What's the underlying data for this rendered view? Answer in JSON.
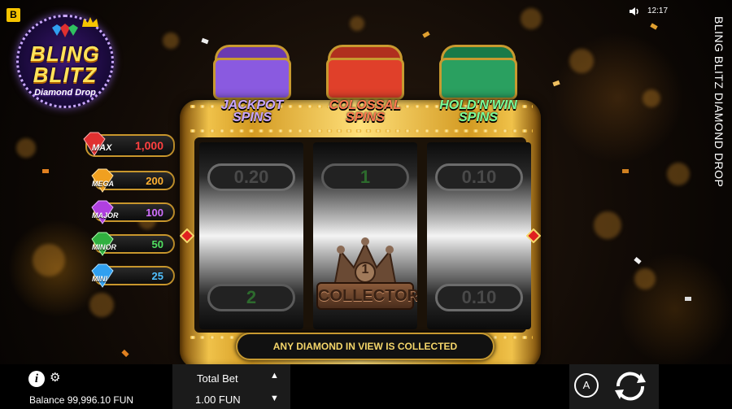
{
  "brand_badge": "B",
  "logo": {
    "line1": "BLING",
    "line2": "BLITZ",
    "subtitle": "Diamond Drop"
  },
  "status": {
    "time": "12:17",
    "sound_icon": "speaker-icon"
  },
  "side_title": "BLING BLITZ DIAMOND DROP",
  "jackpots": [
    {
      "name": "MAX",
      "value": "1,000",
      "color": "#e03030"
    },
    {
      "name": "MEGA",
      "value": "200",
      "color": "#f0a020"
    },
    {
      "name": "MAJOR",
      "value": "100",
      "color": "#b040e0"
    },
    {
      "name": "MINOR",
      "value": "50",
      "color": "#30b040"
    },
    {
      "name": "MINI",
      "value": "25",
      "color": "#30a0f0"
    }
  ],
  "chests": [
    {
      "label_line1": "JACKPOT",
      "label_line2": "SPINS",
      "color": "#8a5ae0",
      "text_color": "#c9a6ff"
    },
    {
      "label_line1": "COLOSSAL",
      "label_line2": "SPINS",
      "color": "#e0402a",
      "text_color": "#ff7a50"
    },
    {
      "label_line1": "HOLD'N'WIN",
      "label_line2": "SPINS",
      "color": "#2aa060",
      "text_color": "#7aff9a"
    }
  ],
  "reels": {
    "reel1": {
      "top": "0.20",
      "bottom": "2"
    },
    "reel2": {
      "top": "1",
      "collector_number": "1",
      "collector_label": "COLLECTOR"
    },
    "reel3": {
      "top": "0.10",
      "bottom": "0.10"
    }
  },
  "message": "ANY DIAMOND IN VIEW IS COLLECTED",
  "bottom_bar": {
    "info_label": "i",
    "balance": "Balance 99,996.10 FUN",
    "total_bet_label": "Total Bet",
    "total_bet_value": "1.00 FUN",
    "autoplay_label": "A"
  },
  "colors": {
    "gold": "#c89a30",
    "message_text": "#f5d66a"
  }
}
